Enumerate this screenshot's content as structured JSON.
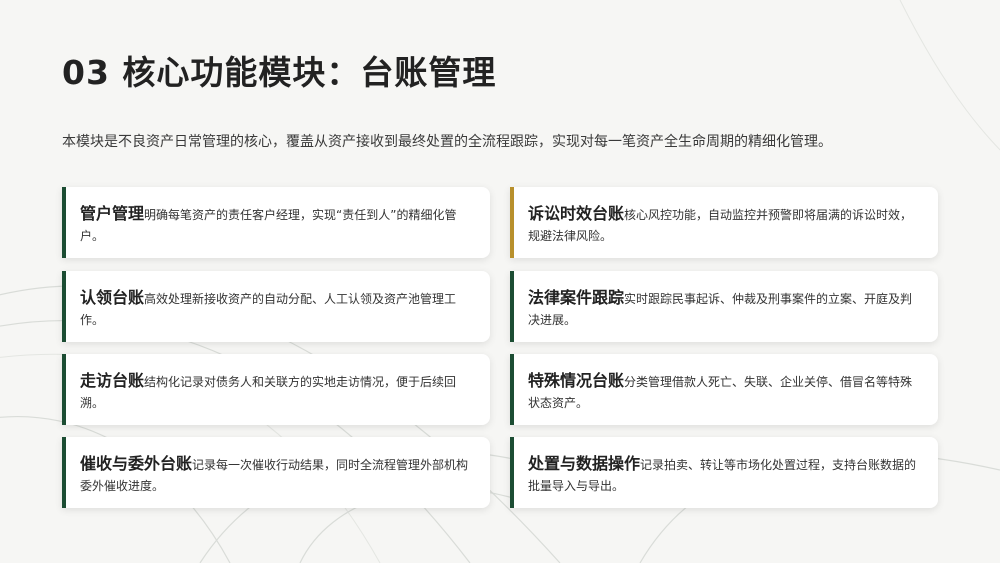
{
  "title": "03 核心功能模块：台账管理",
  "subtitle": "本模块是不良资产日常管理的核心，覆盖从资产接收到最终处置的全流程跟踪，实现对每一笔资产全生命周期的精细化管理。",
  "colors": {
    "accent": "#1c4d33",
    "highlight": "#b8902c"
  },
  "cards": [
    {
      "head": "管户管理",
      "text": "明确每笔资产的责任客户经理，实现“责任到人”的精细化管户。"
    },
    {
      "head": "诉讼时效台账",
      "text": "核心风控功能，自动监控并预警即将届满的诉讼时效，规避法律风险。"
    },
    {
      "head": "认领台账",
      "text": "高效处理新接收资产的自动分配、人工认领及资产池管理工作。"
    },
    {
      "head": "法律案件跟踪",
      "text": "实时跟踪民事起诉、仲裁及刑事案件的立案、开庭及判决进展。"
    },
    {
      "head": "走访台账",
      "text": "结构化记录对债务人和关联方的实地走访情况，便于后续回溯。"
    },
    {
      "head": "特殊情况台账",
      "text": "分类管理借款人死亡、失联、企业关停、借冒名等特殊状态资产。"
    },
    {
      "head": "催收与委外台账",
      "text": "记录每一次催收行动结果，同时全流程管理外部机构委外催收进度。"
    },
    {
      "head": "处置与数据操作",
      "text": "记录拍卖、转让等市场化处置过程，支持台账数据的批量导入与导出。"
    }
  ]
}
